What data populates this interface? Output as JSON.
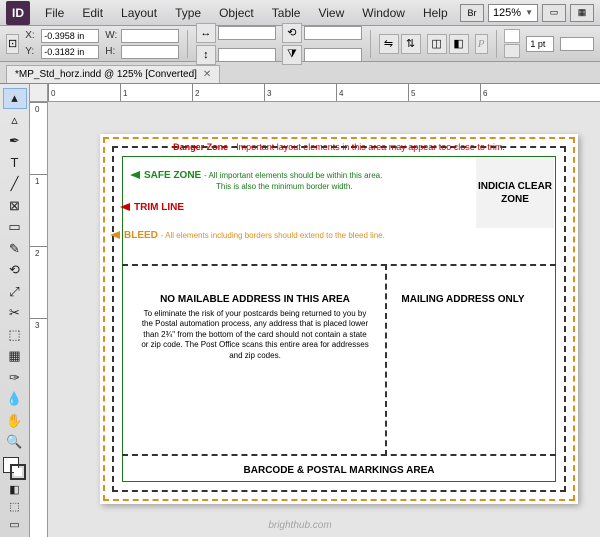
{
  "menu": [
    "File",
    "Edit",
    "Layout",
    "Type",
    "Object",
    "Table",
    "View",
    "Window",
    "Help"
  ],
  "app_icon": "ID",
  "br_label": "Br",
  "zoom": "125%",
  "ctrl": {
    "x_label": "X:",
    "x_val": "-0.3958 in",
    "y_label": "Y:",
    "y_val": "-0.3182 in",
    "w_label": "W:",
    "w_val": "",
    "h_label": "H:",
    "h_val": "",
    "stroke_pt": "1 pt"
  },
  "tab": {
    "title": "*MP_Std_horz.indd @ 125% [Converted]"
  },
  "ruler_h": [
    "0",
    "1",
    "2",
    "3",
    "4",
    "5",
    "6"
  ],
  "ruler_v": [
    "0",
    "1",
    "2",
    "3"
  ],
  "doc": {
    "danger_b": "Danger Zone",
    "danger_t": " - Important layout elements in this area may appear too close to trim.",
    "safe_b": "SAFE ZONE",
    "safe_t1": " - All important elements should be within this area.",
    "safe_t2": "This is also the minimum border width.",
    "trim_b": "TRIM LINE",
    "bleed_b": "BLEED",
    "bleed_t": " - All elements including borders should extend to the bleed line.",
    "indicia": "INDICIA CLEAR ZONE",
    "nomail_h": "NO MAILABLE ADDRESS IN THIS AREA",
    "nomail_d": "To eliminate the risk of your postcards being returned to you by the Postal automation process, any address that is placed lower than 2¾\" from the bottom of the card should not contain a state or zip code. The Post Office scans this entire area for addresses and zip codes.",
    "mail_h": "MAILING ADDRESS ONLY",
    "barcode": "BARCODE & POSTAL MARKINGS AREA"
  },
  "watermark": "brighthub.com"
}
